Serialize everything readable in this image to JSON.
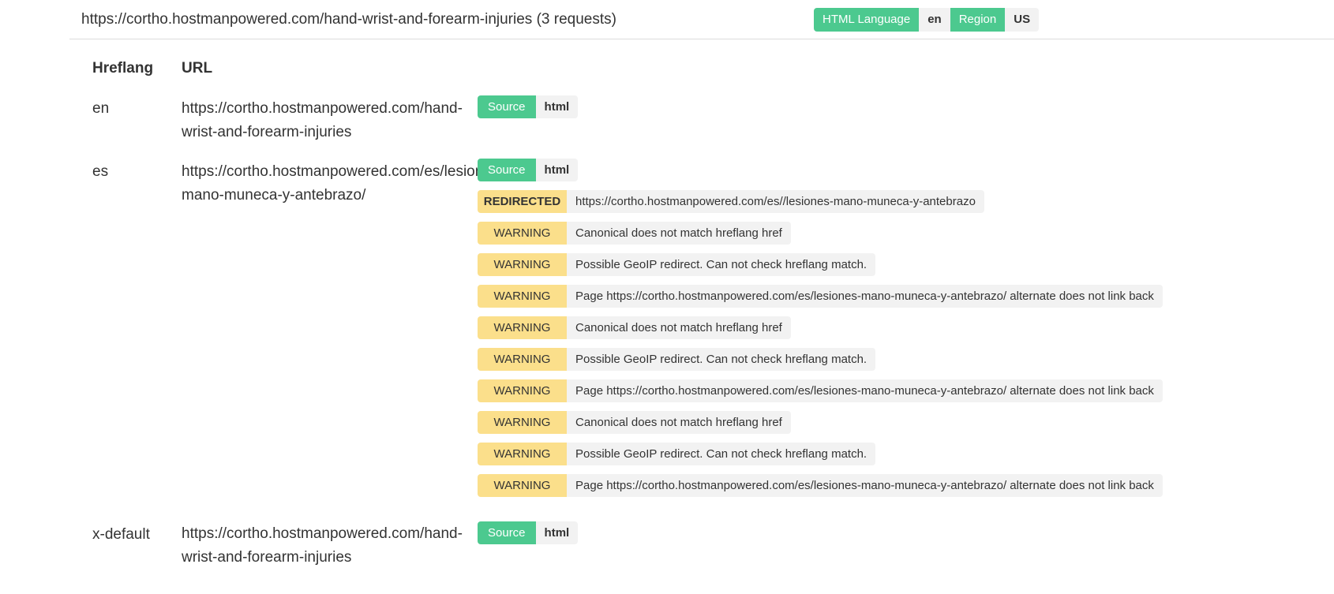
{
  "header": {
    "title": "https://cortho.hostmanpowered.com/hand-wrist-and-forearm-injuries (3 requests)",
    "html_language_label": "HTML Language",
    "html_language_value": "en",
    "region_label": "Region",
    "region_value": "US"
  },
  "table": {
    "col_hreflang": "Hreflang",
    "col_url": "URL",
    "rows": [
      {
        "hreflang": "en",
        "url_line1": "https://cortho.hostmanpowered.com/hand-",
        "url_line2": "wrist-and-forearm-injuries",
        "source_label": "Source",
        "source_value": "html"
      },
      {
        "hreflang": "es",
        "url_line1": "https://cortho.hostmanpowered.com/es/lesiones-",
        "url_line2": "mano-muneca-y-antebrazo/",
        "source_label": "Source",
        "source_value": "html",
        "messages": [
          {
            "level": "REDIRECTED",
            "text": "https://cortho.hostmanpowered.com/es//lesiones-mano-muneca-y-antebrazo"
          },
          {
            "level": "WARNING",
            "text": "Canonical does not match hreflang href"
          },
          {
            "level": "WARNING",
            "text": "Possible GeoIP redirect. Can not check hreflang match."
          },
          {
            "level": "WARNING",
            "text": "Page https://cortho.hostmanpowered.com/es/lesiones-mano-muneca-y-antebrazo/ alternate does not link back"
          },
          {
            "level": "WARNING",
            "text": "Canonical does not match hreflang href"
          },
          {
            "level": "WARNING",
            "text": "Possible GeoIP redirect. Can not check hreflang match."
          },
          {
            "level": "WARNING",
            "text": "Page https://cortho.hostmanpowered.com/es/lesiones-mano-muneca-y-antebrazo/ alternate does not link back"
          },
          {
            "level": "WARNING",
            "text": "Canonical does not match hreflang href"
          },
          {
            "level": "WARNING",
            "text": "Possible GeoIP redirect. Can not check hreflang match."
          },
          {
            "level": "WARNING",
            "text": "Page https://cortho.hostmanpowered.com/es/lesiones-mano-muneca-y-antebrazo/ alternate does not link back"
          }
        ]
      },
      {
        "hreflang": "x-default",
        "url_line1": "https://cortho.hostmanpowered.com/hand-",
        "url_line2": "wrist-and-forearm-injuries",
        "source_label": "Source",
        "source_value": "html"
      }
    ]
  },
  "colors": {
    "source_green": "#4cc98f",
    "warning_yellow": "#fbdf8b",
    "tag_gray": "#f2f2f2"
  }
}
